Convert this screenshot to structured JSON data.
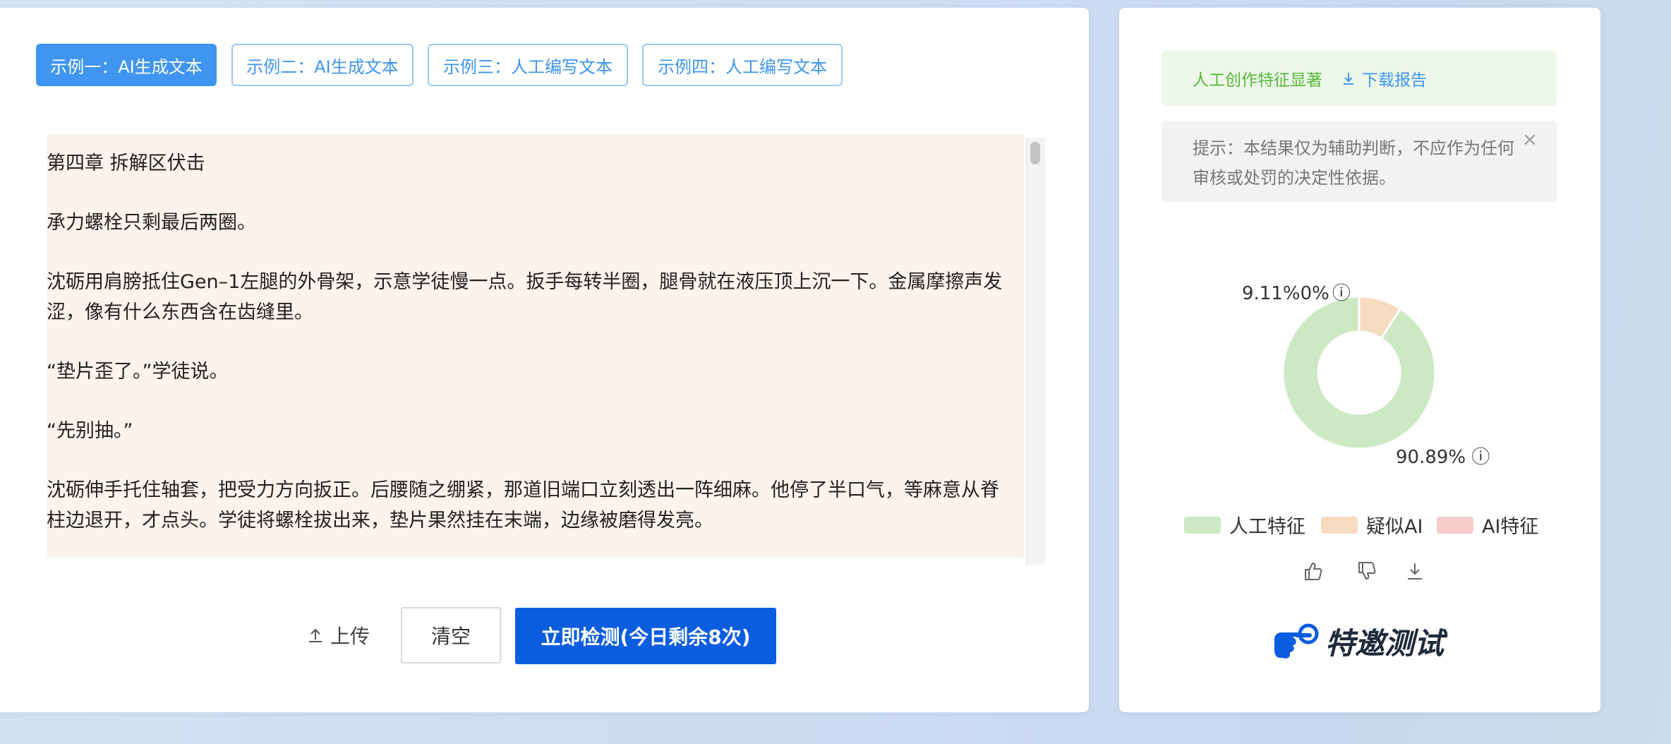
{
  "tabs": [
    {
      "label": "示例一：AI生成文本",
      "active": true
    },
    {
      "label": "示例二：AI生成文本",
      "active": false
    },
    {
      "label": "示例三：人工编写文本",
      "active": false
    },
    {
      "label": "示例四：人工编写文本",
      "active": false
    }
  ],
  "editor": {
    "paragraphs": [
      "第四章 拆解区伏击",
      "承力螺栓只剩最后两圈。",
      "沈砺用肩膀抵住Gen–1左腿的外骨架，示意学徒慢一点。扳手每转半圈，腿骨就在液压顶上沉一下。金属摩擦声发涩，像有什么东西含在齿缝里。",
      "“垫片歪了。”学徒说。",
      "“先别抽。”",
      "沈砺伸手托住轴套，把受力方向扳正。后腰随之绷紧，那道旧端口立刻透出一阵细麻。他停了半口气，等麻意从脊柱边退开，才点头。学徒将螺栓拔出来，垫片果然挂在末端，边缘被磨得发亮。"
    ]
  },
  "actions": {
    "upload_label": "上传",
    "clear_label": "清空",
    "detect_label": "立即检测(今日剩余8次)"
  },
  "result": {
    "verdict": "人工创作特征显著",
    "download_label": "下载报告",
    "notice": "提示：本结果仅为辅助判断，不应作为任何审核或处罚的决定性依据。",
    "close_glyph": "×"
  },
  "chart_data": {
    "type": "pie",
    "style": "donut",
    "slices": [
      {
        "label": "人工特征",
        "value": 90.89,
        "display": "90.89%",
        "color": "#cde9c4"
      },
      {
        "label": "疑似AI",
        "value": 9.11,
        "display": "9.11%",
        "color": "#f7dcc0"
      },
      {
        "label": "AI特征",
        "value": 0,
        "display": "0%",
        "color": "#f7cccc"
      }
    ],
    "info_glyph": "ⓘ",
    "legend_placement": "bottom"
  },
  "legend": {
    "items": [
      {
        "label": "人工特征",
        "color": "#cde9c4"
      },
      {
        "label": "疑似AI",
        "color": "#f7dcc0"
      },
      {
        "label": "AI特征",
        "color": "#f7cccc"
      }
    ]
  },
  "feedback_icons": [
    "thumbs-up-icon",
    "thumbs-down-icon",
    "download-icon"
  ],
  "invite": {
    "label": "特邀测试"
  },
  "colors": {
    "primary": "#0b5de0",
    "accent": "#3f95f0",
    "success": "#55b73a"
  }
}
